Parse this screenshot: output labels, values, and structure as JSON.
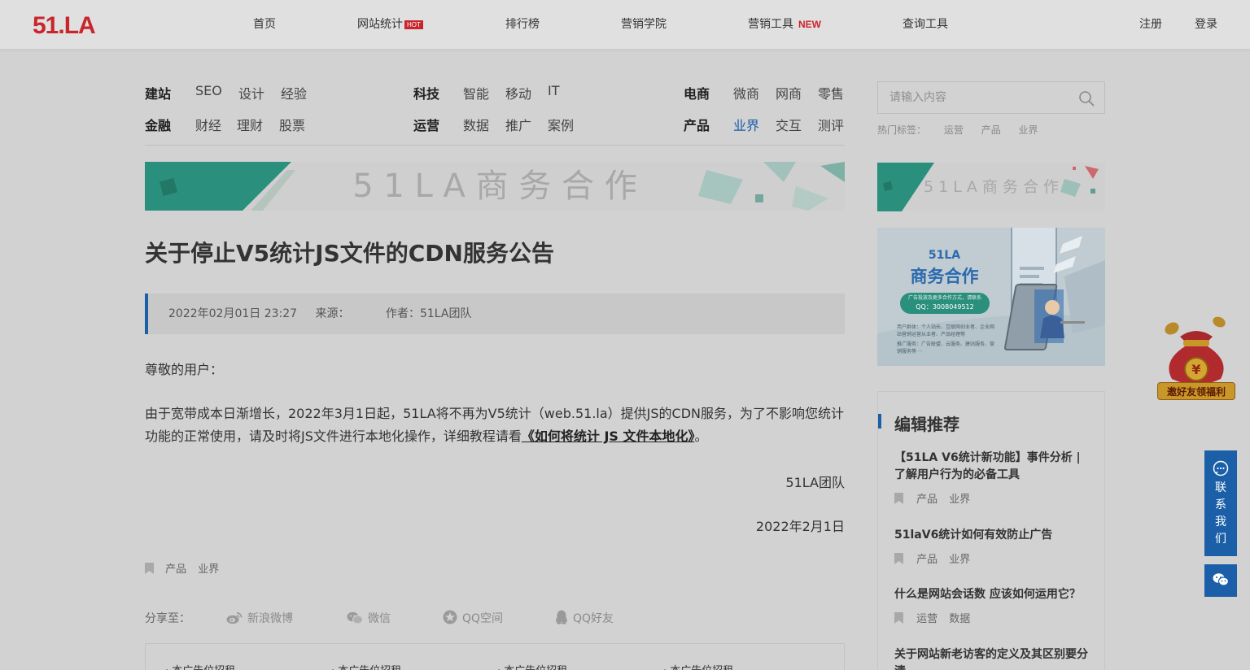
{
  "header": {
    "logo_text": "51.LA",
    "nav": [
      {
        "label": "首页"
      },
      {
        "label": "网站统计",
        "badge": "HOT"
      },
      {
        "label": "排行榜"
      },
      {
        "label": "营销学院"
      },
      {
        "label": "营销工具",
        "badge": "NEW"
      },
      {
        "label": "查询工具"
      }
    ],
    "register": "注册",
    "login": "登录"
  },
  "categories": {
    "group1": {
      "title1": "建站",
      "links1": [
        "SEO",
        "设计",
        "经验"
      ],
      "title2": "金融",
      "links2": [
        "财经",
        "理财",
        "股票"
      ]
    },
    "group2": {
      "title1": "科技",
      "links1": [
        "智能",
        "移动",
        "IT"
      ],
      "title2": "运营",
      "links2": [
        "数据",
        "推广",
        "案例"
      ]
    },
    "group3": {
      "title1": "电商",
      "links1": [
        "微商",
        "网商",
        "零售"
      ],
      "title2": "产品",
      "links2": [
        "业界",
        "交互",
        "测评"
      ]
    }
  },
  "search": {
    "placeholder": "请输入内容",
    "hot_label": "热门标签：",
    "hot_tags": [
      "运营",
      "产品",
      "业界"
    ]
  },
  "banner_main_text": "5 1 L A 商 务 合 作",
  "banner_side_text": "5 1 L A 商 务 合 作",
  "promo": {
    "line1": "51LA",
    "line2": "商务合作",
    "pill": "广告投放及更多合作方式，请联系",
    "qq": "QQ：3008049512",
    "note1": "用户群体：个人站长、互联网创业者、企业网",
    "note2": "站营销运营从业者、产品经理等",
    "note3": "推广服务：广告联盟、云服务、建站服务、营",
    "note4": "销服务等 ···"
  },
  "article": {
    "title": "关于停止V5统计JS文件的CDN服务公告",
    "date": "2022年02月01日 23:27",
    "source": "来源：",
    "author": "作者：51LA团队",
    "greeting": "尊敬的用户：",
    "body": "由于宽带成本日渐增长，2022年3月1日起，51LA将不再为V5统计（web.51.la）提供JS的CDN服务，为了不影响您统计功能的正常使用，请及时将JS文件进行本地化操作，详细教程请看",
    "link": "《如何将统计 JS 文件本地化》",
    "end_period": "。",
    "signature": "51LA团队",
    "sign_date": "2022年2月1日",
    "tags": [
      "产品",
      "业界"
    ]
  },
  "share": {
    "label": "分享至：",
    "weibo": "新浪微博",
    "wechat": "微信",
    "qzone": "QQ空间",
    "qq": "QQ好友"
  },
  "ads": [
    "· 本广告位招租",
    "· 本广告位招租",
    "· 本广告位招租",
    "· 本广告位招租"
  ],
  "recommend": {
    "heading": "编辑推荐",
    "items": [
      {
        "title": "【51LA V6统计新功能】事件分析 | 了解用户行为的必备工具",
        "tags": [
          "产品",
          "业界"
        ]
      },
      {
        "title": "51laV6统计如何有效防止广告",
        "tags": [
          "产品",
          "业界"
        ]
      },
      {
        "title": "什么是网站会话数 应该如何运用它？",
        "tags": [
          "运营",
          "数据"
        ]
      },
      {
        "title": "关于网站新老访客的定义及其区别要分清",
        "tags": []
      }
    ]
  },
  "widgets": {
    "gift_label": "邀好友领福利",
    "contact_chars": [
      "联",
      "系",
      "我",
      "们"
    ]
  },
  "colors": {
    "brand_red": "#c9252c",
    "accent_blue": "#1a5fa8",
    "teal": "#2a8f7c",
    "overlay_bg": "#d2d2d2"
  }
}
